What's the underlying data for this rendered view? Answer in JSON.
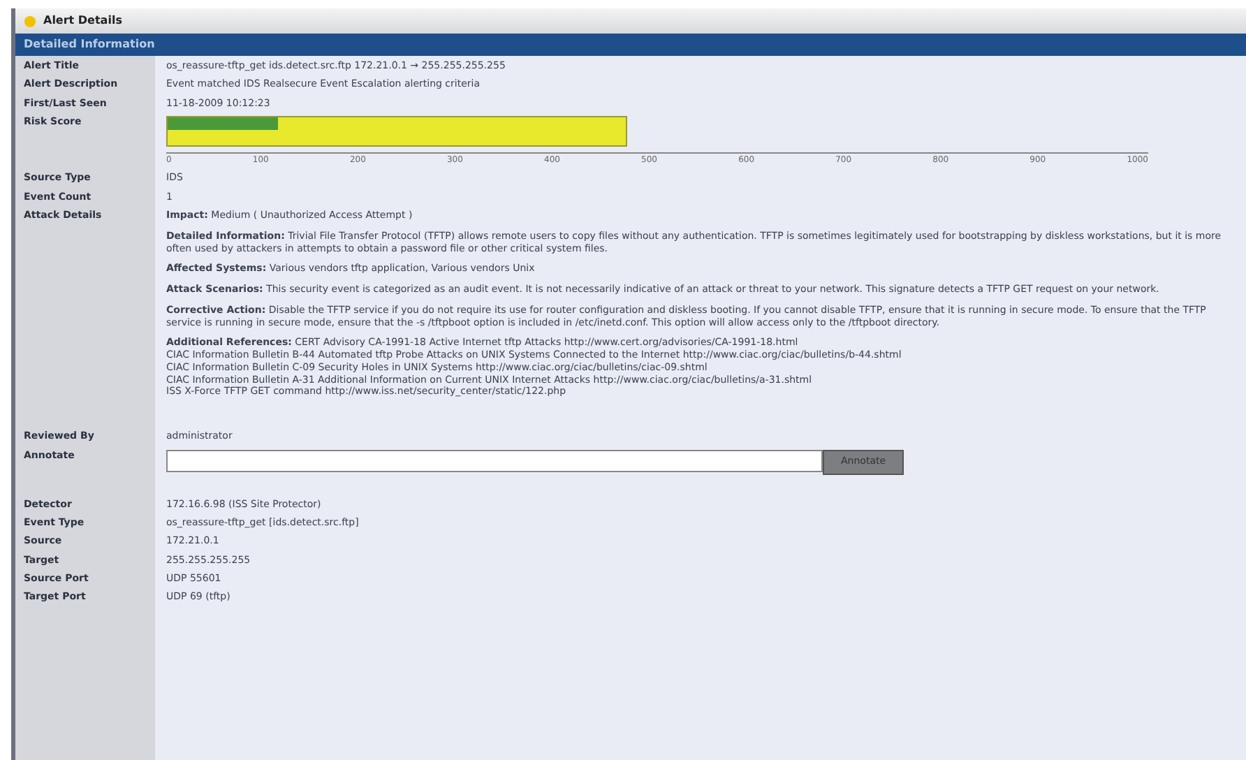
{
  "window": {
    "title": "Alert Details"
  },
  "section": {
    "title": "Detailed Information"
  },
  "rows": [
    {
      "kind": "text",
      "label": "Alert Title",
      "value": "os_reassure-tftp_get ids.detect.src.ftp 172.21.0.1 → 255.255.255.255"
    },
    {
      "kind": "text",
      "label": "Alert Description",
      "value": "Event matched IDS Realsecure Event Escalation alerting criteria"
    },
    {
      "kind": "text",
      "label": "First/Last Seen",
      "value": "11-18-2009 10:12:23"
    },
    {
      "kind": "risk",
      "label": "Risk Score",
      "level": 0.24,
      "ticks": [
        "0",
        "100",
        "200",
        "300",
        "400",
        "500",
        "600",
        "700",
        "800",
        "900",
        "1000"
      ]
    },
    {
      "kind": "text",
      "label": "Source Type",
      "value": "IDS"
    },
    {
      "kind": "text",
      "label": "Event Count",
      "value": "1"
    },
    {
      "kind": "details",
      "label": "Attack Details",
      "paragraphs": [
        {
          "lines": [
            "**Impact:** Medium ( Unauthorized Access Attempt )"
          ]
        },
        {
          "lines": [
            "**Detailed Information:** Trivial File Transfer Protocol (TFTP) allows remote users to copy files without any authentication. TFTP is sometimes legitimately used for bootstrapping by diskless workstations, but it is more often used by attackers in attempts to obtain a password file or other critical system files."
          ]
        },
        {
          "lines": [
            "**Affected Systems:** Various vendors tftp application, Various vendors Unix"
          ]
        },
        {
          "lines": [
            "**Attack Scenarios:** This security event is categorized as an audit event. It is not necessarily indicative of an attack or threat to your network. This signature detects a TFTP GET request on your network."
          ]
        },
        {
          "lines": [
            "**Corrective Action:** Disable the TFTP service if you do not require its use for router configuration and diskless booting. If you cannot disable TFTP, ensure that it is running in secure mode. To ensure that the TFTP service is running in secure mode, ensure that the -s /tftpboot option is included in /etc/inetd.conf. This option will allow access only to the /tftpboot directory."
          ]
        },
        {
          "lines": [
            "**Additional References:** CERT Advisory CA-1991-18 Active Internet tftp Attacks http://www.cert.org/advisories/CA-1991-18.html",
            "CIAC Information Bulletin B-44 Automated tftp Probe Attacks on UNIX Systems Connected to the Internet http://www.ciac.org/ciac/bulletins/b-44.shtml",
            "CIAC Information Bulletin C-09 Security Holes in UNIX Systems http://www.ciac.org/ciac/bulletins/ciac-09.shtml",
            "CIAC Information Bulletin A-31 Additional Information on Current UNIX Internet Attacks http://www.ciac.org/ciac/bulletins/a-31.shtml",
            "ISS X-Force TFTP GET command http://www.iss.net/security_center/static/122.php"
          ]
        }
      ]
    },
    {
      "kind": "text",
      "label": "Reviewed By",
      "value": "administrator"
    },
    {
      "kind": "annotate",
      "label": "Annotate",
      "button": "Annotate"
    },
    {
      "kind": "text",
      "label": "Detector",
      "value": "172.16.6.98 (ISS Site Protector)"
    },
    {
      "kind": "text",
      "label": "Event Type",
      "value": "os_reassure-tftp_get [ids.detect.src.ftp]"
    },
    {
      "kind": "text",
      "label": "Source",
      "value": "172.21.0.1"
    },
    {
      "kind": "text",
      "label": "Target",
      "value": "255.255.255.255"
    },
    {
      "kind": "text",
      "label": "Source Port",
      "value": "UDP 55601"
    },
    {
      "kind": "text",
      "label": "Target Port",
      "value": "UDP 69 (tftp)"
    }
  ]
}
